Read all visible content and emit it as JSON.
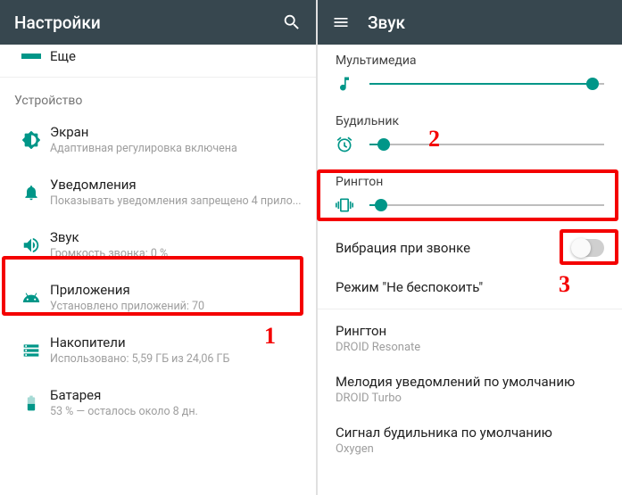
{
  "left": {
    "appbar": {
      "title": "Настройки"
    },
    "more_label": "Еще",
    "section": "Устройство",
    "items": {
      "display": {
        "title": "Экран",
        "sub": "Адаптивная регулировка включена"
      },
      "notif": {
        "title": "Уведомления",
        "sub": "Показывать уведомления запрещено 4 прило..."
      },
      "sound": {
        "title": "Звук",
        "sub": "Громкость звонка: 0 %"
      },
      "apps": {
        "title": "Приложения",
        "sub": "Установлено приложений: 70"
      },
      "storage": {
        "title": "Накопители",
        "sub": "Использовано: 5,59 ГБ из 24,06 ГБ"
      },
      "battery": {
        "title": "Батарея",
        "sub": "53 % — осталось около 8 дн."
      }
    }
  },
  "right": {
    "appbar": {
      "title": "Звук"
    },
    "sliders": {
      "media": {
        "label": "Мультимедиа",
        "percent": 95
      },
      "alarm": {
        "label": "Будильник",
        "percent": 6
      },
      "ring": {
        "label": "Рингтон",
        "percent": 5
      }
    },
    "vibrate": {
      "label": "Вибрация при звонке",
      "on": false
    },
    "dnd": {
      "label": "Режим \"Не беспокоить\""
    },
    "prefs": {
      "ringtone": {
        "title": "Рингтон",
        "value": "DROID Resonate"
      },
      "notif": {
        "title": "Мелодия уведомлений по умолчанию",
        "value": "DROID Turbo"
      },
      "alarm": {
        "title": "Сигнал будильника по умолчанию",
        "value": "Oxygen"
      }
    }
  },
  "annotations": {
    "a1": "1",
    "a2": "2",
    "a3": "3"
  },
  "colors": {
    "accent": "#009688",
    "appbar": "#37474f",
    "highlight": "#f40000"
  }
}
